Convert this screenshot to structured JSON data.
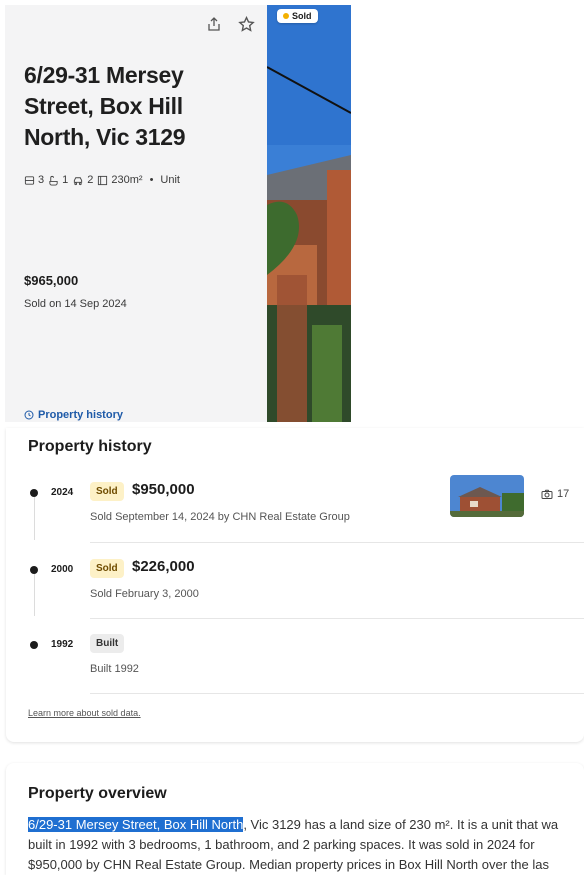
{
  "card": {
    "address": "6/29-31 Mersey Street, Box Hill North, Vic 3129",
    "beds": "3",
    "baths": "1",
    "parking": "2",
    "land": "230m²",
    "type": "Unit",
    "price": "$965,000",
    "sold_date": "Sold on 14 Sep 2024",
    "history_link": "Property history",
    "photo_badge": "Sold"
  },
  "history": {
    "title": "Property history",
    "events": [
      {
        "year": "2024",
        "badge": "Sold",
        "price": "$950,000",
        "desc": "Sold September 14, 2024 by CHN Real Estate Group",
        "photo_count": "17"
      },
      {
        "year": "2000",
        "badge": "Sold",
        "price": "$226,000",
        "desc": "Sold February 3, 2000"
      },
      {
        "year": "1992",
        "badge": "Built",
        "price": "",
        "desc": "Built 1992"
      }
    ],
    "learn_more": "Learn more about sold data."
  },
  "overview": {
    "title": "Property overview",
    "highlight": "6/29-31 Mersey Street, Box Hill North",
    "line1_rest": ", Vic 3129 has a land size of 230 m². It is a unit that wa",
    "line2": "built in 1992 with 3 bedrooms, 1 bathroom, and 2 parking spaces. It was sold in 2024 for",
    "line3": "$950,000 by CHN Real Estate Group. Median property prices in Box Hill North over the las"
  },
  "colors": {
    "accent": "#1e5aa8",
    "sold_badge_bg": "#fdf1c7",
    "highlight": "#1f6fd1"
  },
  "icons": [
    "share-icon",
    "star-icon",
    "bed-icon",
    "bath-icon",
    "car-icon",
    "land-icon",
    "clock-icon",
    "camera-icon"
  ]
}
